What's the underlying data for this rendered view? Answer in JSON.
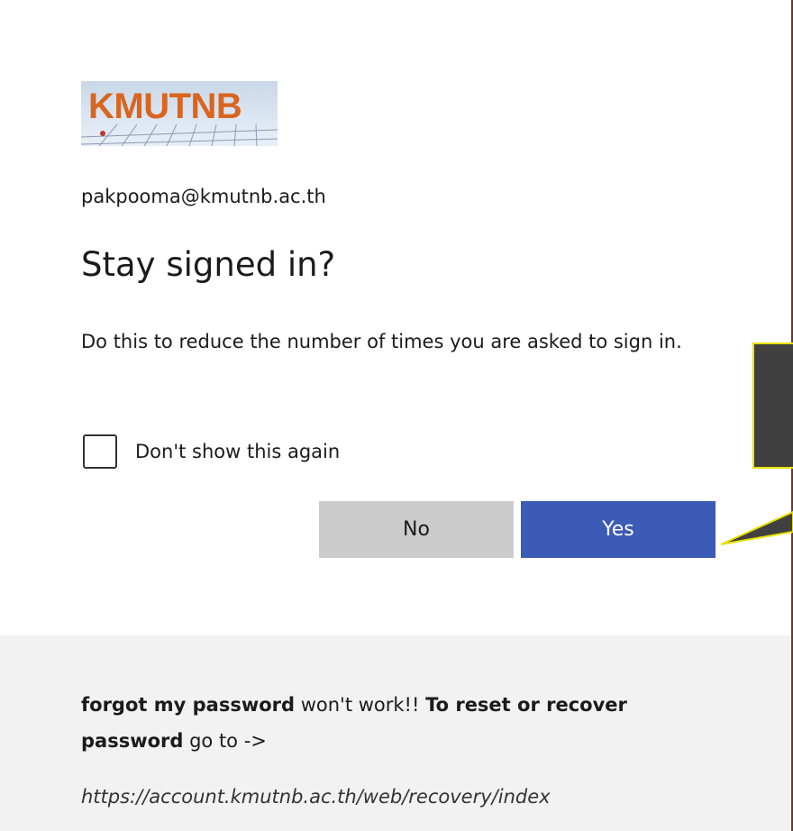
{
  "logo": {
    "text": "KMUTNB",
    "color": "#d9651f"
  },
  "account": {
    "email": "pakpooma@kmutnb.ac.th"
  },
  "dialog": {
    "title": "Stay signed in?",
    "description": "Do this to reduce the number of times you are asked to sign in.",
    "checkbox_label": "Don't show this again",
    "checkbox_checked": false,
    "no_label": "No",
    "yes_label": "Yes",
    "yes_color": "#3b5bb5",
    "no_color": "#cccccc"
  },
  "callout": {
    "box_color": "#404040",
    "border_color": "#e8e000"
  },
  "footer": {
    "part1_bold": "forgot my password",
    "part2": " won't work!! ",
    "part3_bold": "To reset or recover password",
    "part4": " go to ->",
    "link": "https://account.kmutnb.ac.th/web/recovery/index"
  }
}
